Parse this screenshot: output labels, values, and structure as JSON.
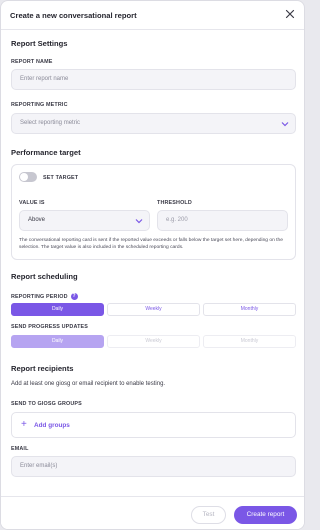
{
  "dialog": {
    "title": "Create a new conversational report"
  },
  "settings": {
    "heading": "Report Settings",
    "name_label": "REPORT NAME",
    "name_placeholder": "Enter report name",
    "metric_label": "REPORTING METRIC",
    "metric_placeholder": "Select reporting metric"
  },
  "target": {
    "heading": "Performance target",
    "toggle_label": "SET TARGET",
    "value_is_label": "VALUE IS",
    "value_is_selected": "Above",
    "threshold_label": "THRESHOLD",
    "threshold_placeholder": "e.g. 200",
    "help": "The conversational reporting card is sent if the reported value exceeds or falls below the target set here, depending on the selection. The target value is also included in the scheduled reporting cards."
  },
  "scheduling": {
    "heading": "Report scheduling",
    "period_label": "REPORTING PERIOD",
    "period_options": [
      "Daily",
      "Weekly",
      "Monthly"
    ],
    "updates_label": "SEND PROGRESS UPDATES",
    "updates_options": [
      "Daily",
      "Weekly",
      "Monthly"
    ]
  },
  "recipients": {
    "heading": "Report recipients",
    "hint": "Add at least one giosg or email recipient to enable testing.",
    "groups_label": "SEND TO GIOSG GROUPS",
    "add_groups": "Add groups",
    "email_label": "EMAIL",
    "email_placeholder": "Enter email(s)"
  },
  "footer": {
    "test_label": "Test",
    "create_label": "Create report"
  },
  "colors": {
    "accent": "#7a57e6",
    "accent_disabled": "#b6a4f1"
  }
}
